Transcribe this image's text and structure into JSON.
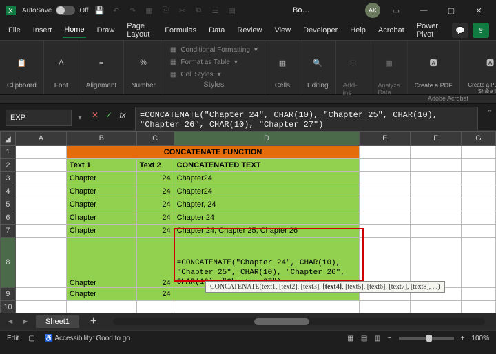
{
  "titlebar": {
    "autosave": "AutoSave",
    "autosave_state": "Off",
    "doc": "Bo…",
    "avatar": "AK"
  },
  "menu": {
    "items": [
      "File",
      "Insert",
      "Home",
      "Draw",
      "Page Layout",
      "Formulas",
      "Data",
      "Review",
      "View",
      "Developer",
      "Help",
      "Acrobat",
      "Power Pivot"
    ],
    "active": "Home"
  },
  "ribbon": {
    "clipboard": "Clipboard",
    "font": "Font",
    "alignment": "Alignment",
    "number": "Number",
    "styles": "Styles",
    "cond": "Conditional Formatting",
    "fmtTable": "Format as Table",
    "cellStyles": "Cell Styles",
    "cells": "Cells",
    "editing": "Editing",
    "addins": "Add-ins",
    "analyze": "Analyze Data",
    "createpdf": "Create a PDF",
    "sharepdf": "Create a PDF and Share link",
    "acrobat": "Adobe Acrobat"
  },
  "namebox": "EXP",
  "formula": "=CONCATENATE(\"Chapter 24\", CHAR(10), \"Chapter 25\", CHAR(10), \"Chapter 26\", CHAR(10), \"Chapter 27\")",
  "cols": [
    "",
    "A",
    "B",
    "C",
    "D",
    "E",
    "F",
    "G"
  ],
  "spreadsheet": {
    "title": "CONCATENATE FUNCTION",
    "headers": {
      "t1": "Text 1",
      "t2": "Text 2",
      "res": "CONCATENATED TEXT"
    },
    "rows": [
      {
        "t1": "Chapter",
        "t2": "24",
        "res": "Chapter24"
      },
      {
        "t1": "Chapter",
        "t2": "24",
        "res": "Chapter24"
      },
      {
        "t1": "Chapter",
        "t2": "24",
        "res": "Chapter, 24"
      },
      {
        "t1": "Chapter",
        "t2": "24",
        "res": "Chapter 24"
      },
      {
        "t1": "Chapter",
        "t2": "24",
        "res": "Chapter 24, Chapter 25, Chapter 26"
      }
    ],
    "editing": {
      "t1": "Chapter",
      "t2": "24",
      "formula": "=CONCATENATE(\"Chapter 24\", CHAR(10), \"Chapter 25\", CHAR(10), \"Chapter 26\", CHAR(10), \"Chapter 27\")"
    },
    "row9": {
      "t1": "Chapter",
      "t2": "24"
    }
  },
  "tooltip": {
    "fn": "CONCATENATE(text1, [text2], [text3], ",
    "bold": "[text4]",
    "rest": ", [text5], [text6], [text7], [text8], ...)"
  },
  "sheet": "Sheet1",
  "status": {
    "mode": "Edit",
    "acc": "Accessibility: Good to go",
    "zoom": "100%"
  }
}
